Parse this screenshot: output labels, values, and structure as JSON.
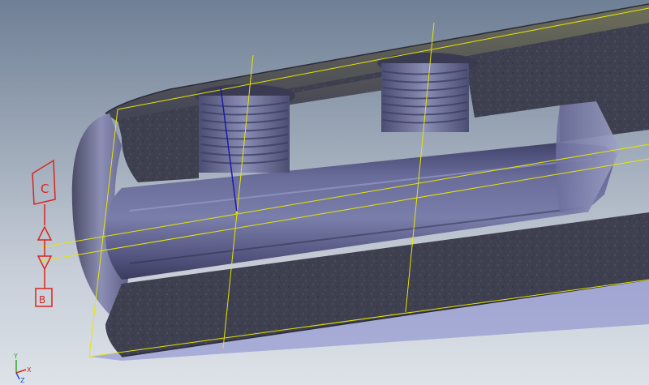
{
  "viewcube": {
    "top_label": "C",
    "bottom_label": "B"
  },
  "triad": {
    "x_label": "X",
    "y_label": "Y",
    "z_label": "Z"
  },
  "colors": {
    "part_fill": "#5c5e8a",
    "section_texture": "#3d3e4d",
    "sketch_lines": "#e6e600",
    "viewcube_red": "#d7261e",
    "background_top": "#6f7f95",
    "background_bottom": "#dde2e8"
  }
}
